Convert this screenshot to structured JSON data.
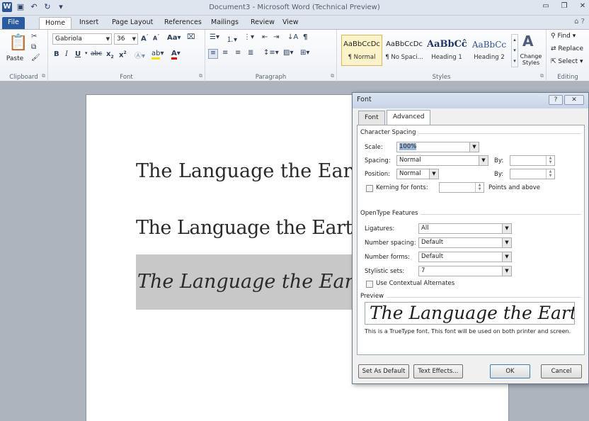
{
  "window": {
    "title": "Document3 - Microsoft Word (Technical Preview)",
    "logo": "W"
  },
  "ribbon_tabs": [
    "File",
    "Home",
    "Insert",
    "Page Layout",
    "References",
    "Mailings",
    "Review",
    "View"
  ],
  "clipboard": {
    "paste_label": "Paste",
    "group_label": "Clipboard"
  },
  "font_group": {
    "font_name": "Gabriola",
    "font_size": "36",
    "group_label": "Font",
    "case_label": "Aa"
  },
  "paragraph_group": {
    "group_label": "Paragraph"
  },
  "styles_group": {
    "styles": [
      {
        "preview": "AaBbCcDc",
        "name": "¶ Normal",
        "selected": true
      },
      {
        "preview": "AaBbCcDc",
        "name": "¶ No Spaci...",
        "selected": false
      },
      {
        "preview": "AaBbCĉ",
        "name": "Heading 1",
        "selected": false
      },
      {
        "preview": "AaBbCc",
        "name": "Heading 2",
        "selected": false
      }
    ],
    "change_styles_label": "Change Styles",
    "group_label": "Styles"
  },
  "editing_group": {
    "find_label": "Find",
    "replace_label": "Replace",
    "select_label": "Select",
    "group_label": "Editing"
  },
  "document": {
    "lines": [
      "The Language the Earth Spea",
      "The Language the Earth Spe",
      "The Language the Earth Spe"
    ]
  },
  "dialog": {
    "title": "Font",
    "help_label": "?",
    "close_label": "✕",
    "tabs": [
      "Font",
      "Advanced"
    ],
    "active_tab": "Advanced",
    "character_spacing": {
      "section_label": "Character Spacing",
      "scale_label": "Scale:",
      "scale_value": "100%",
      "spacing_label": "Spacing:",
      "spacing_value": "Normal",
      "position_label": "Position:",
      "position_value": "Normal",
      "by_label": "By:",
      "by_label2": "By:",
      "kerning_label": "Kerning for fonts:",
      "points_label": "Points and above"
    },
    "opentype": {
      "section_label": "OpenType Features",
      "ligatures_label": "Ligatures:",
      "ligatures_value": "All",
      "number_spacing_label": "Number spacing:",
      "number_spacing_value": "Default",
      "number_forms_label": "Number forms:",
      "number_forms_value": "Default",
      "stylistic_sets_label": "Stylistic sets:",
      "stylistic_sets_value": "7",
      "contextual_label": "Use Contextual Alternates"
    },
    "preview": {
      "section_label": "Preview",
      "text": "The Language the Earth",
      "note": "This is a TrueType font. This font will be used on both printer and screen."
    },
    "buttons": {
      "set_default": "Set As Default",
      "text_effects": "Text Effects...",
      "ok": "OK",
      "cancel": "Cancel"
    }
  }
}
